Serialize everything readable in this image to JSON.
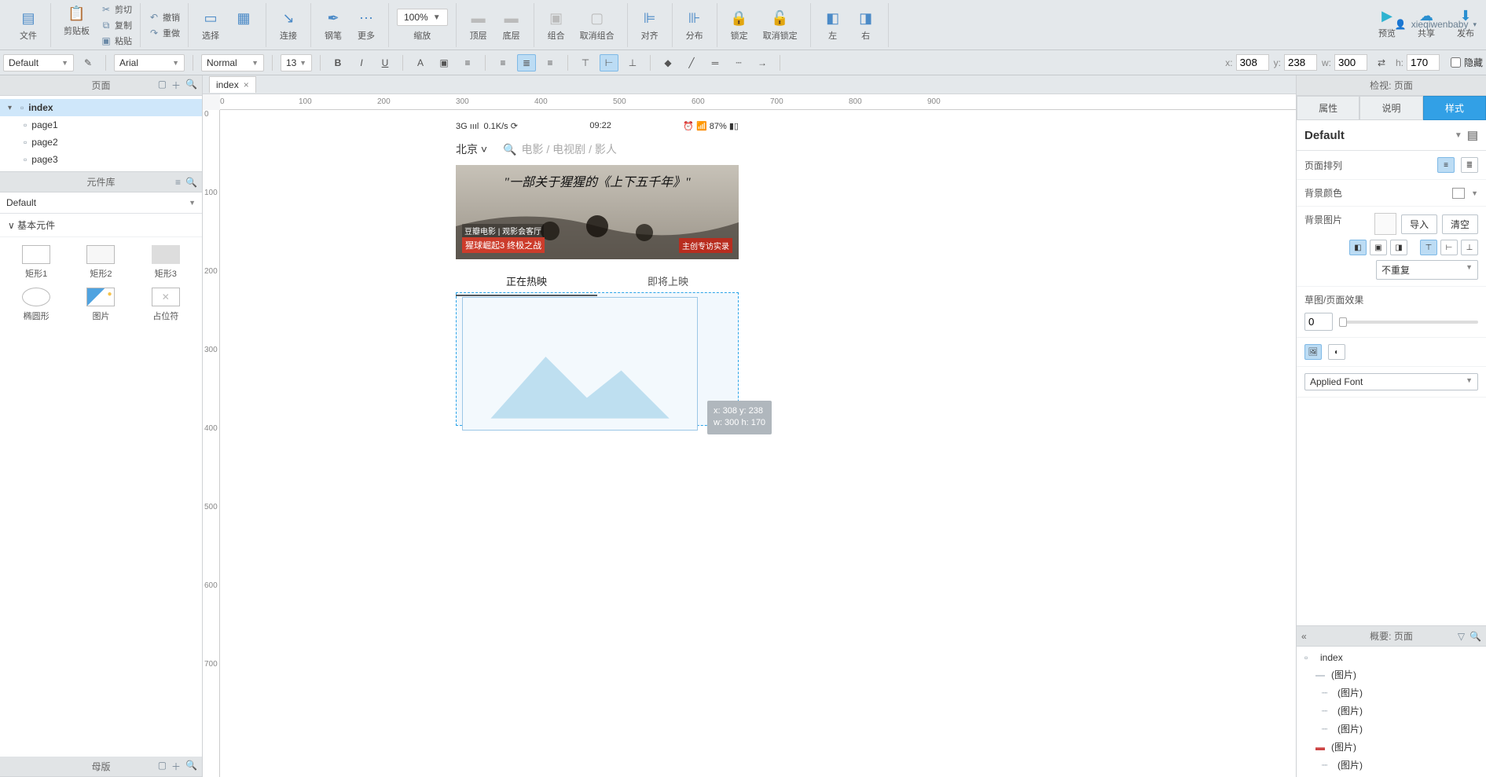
{
  "user": "xieqiwenbaby",
  "toolbar": {
    "file": "文件",
    "clipboard": "剪贴板",
    "cut": "剪切",
    "copy": "复制",
    "paste": "粘贴",
    "undo": "撤销",
    "redo": "重做",
    "select": "选择",
    "connect": "连接",
    "pen": "钢笔",
    "more": "更多",
    "zoom": "100%",
    "scale": "缩放",
    "top": "顶层",
    "bottom": "底层",
    "group": "组合",
    "ungroup": "取消组合",
    "align": "对齐",
    "distribute": "分布",
    "lock": "锁定",
    "unlock": "取消锁定",
    "left": "左",
    "right": "右",
    "preview": "预览",
    "share": "共享",
    "publish": "发布"
  },
  "fmt": {
    "style": "Default",
    "font": "Arial",
    "weight": "Normal",
    "size": "13",
    "x_label": "x:",
    "x": "308",
    "y_label": "y:",
    "y": "238",
    "w_label": "w:",
    "w": "300",
    "h_label": "h:",
    "h": "170",
    "hide": "隐藏"
  },
  "pages": {
    "title": "页面",
    "root": "index",
    "items": [
      "page1",
      "page2",
      "page3"
    ]
  },
  "lib": {
    "title": "元件库",
    "set": "Default",
    "cat": "基本元件",
    "items": [
      "矩形1",
      "矩形2",
      "矩形3",
      "椭圆形",
      "图片",
      "占位符"
    ]
  },
  "master": {
    "title": "母版"
  },
  "tab": {
    "name": "index"
  },
  "ruler_h": [
    "0",
    "100",
    "200",
    "300",
    "400",
    "500",
    "600",
    "700",
    "800",
    "900"
  ],
  "ruler_v": [
    "0",
    "100",
    "200",
    "300",
    "400",
    "500",
    "600",
    "700"
  ],
  "device": {
    "signal": "3G ıııl",
    "speed": "0.1K/s",
    "time": "09:22",
    "battery": "87%",
    "city": "北京",
    "search_placeholder": "电影 / 电视剧 / 影人",
    "banner_title": "\"一部关于猩猩的《上下五千年》\"",
    "banner_sub": "猩球崛起3 终极之战",
    "banner_sub2": "豆瓣电影 | 观影会客厅",
    "banner_tag": "主创专访实录",
    "tabs": [
      "正在热映",
      "即将上映"
    ]
  },
  "drag": {
    "tip_xy": "x: 308   y: 238",
    "tip_wh": "w: 300   h: 170"
  },
  "inspector": {
    "title_bar": "检视: 页面",
    "tabs": [
      "属性",
      "说明",
      "样式"
    ],
    "style_name": "Default",
    "rows": {
      "page_align": "页面排列",
      "bg_color": "背景颜色",
      "bg_image": "背景图片",
      "import": "导入",
      "clear": "清空",
      "repeat": "不重复",
      "sketch": "草图/页面效果",
      "sketch_val": "0",
      "font": "Applied Font"
    }
  },
  "outline": {
    "title": "概要: 页面",
    "root": "index",
    "items": [
      "(图片)",
      "(图片)",
      "(图片)",
      "(图片)",
      "(图片)",
      "(图片)"
    ]
  }
}
